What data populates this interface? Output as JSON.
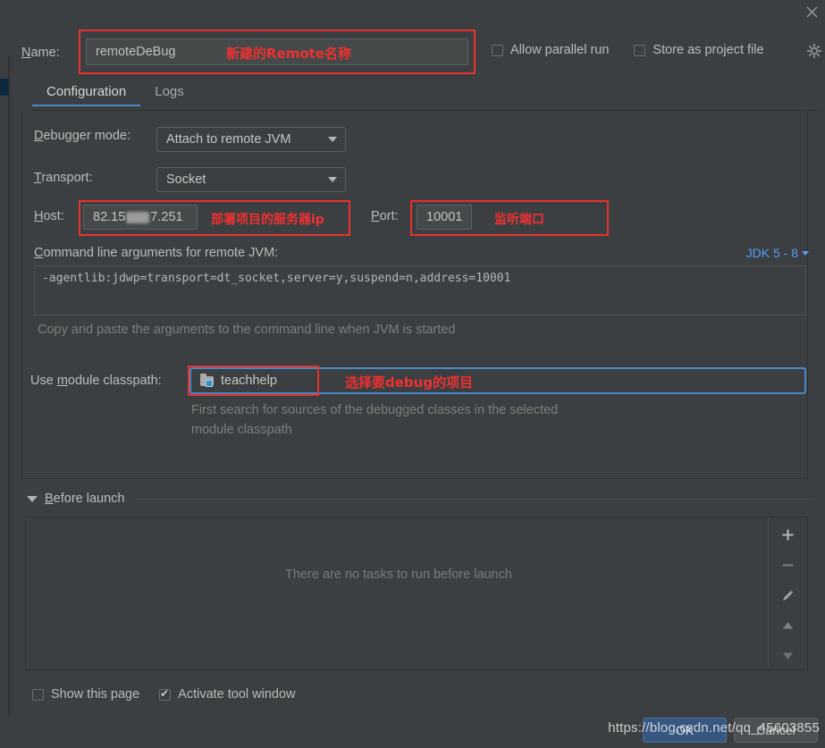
{
  "window": {
    "close_icon": "close-icon",
    "gear_icon": "gear-icon"
  },
  "header": {
    "name_label": "Name:",
    "name_value": "remoteDeBug",
    "name_annotation": "新建的Remote名称",
    "allow_parallel_run_label": "Allow parallel run",
    "allow_parallel_run_checked": false,
    "store_as_project_file_label": "Store as project file",
    "store_as_project_file_checked": false
  },
  "tabs": [
    {
      "label": "Configuration",
      "active": true
    },
    {
      "label": "Logs",
      "active": false
    }
  ],
  "configuration": {
    "debugger_mode_label": "Debugger mode:",
    "debugger_mode_value": "Attach to remote JVM",
    "transport_label": "Transport:",
    "transport_value": "Socket",
    "host_label": "Host:",
    "host_value_prefix": "82.15",
    "host_value_suffix": "7.251",
    "host_annotation": "部署项目的服务器ip",
    "port_label": "Port:",
    "port_value": "10001",
    "port_annotation": "监听端口",
    "cmdline_label": "Command line arguments for remote JVM:",
    "jdk_link": "JDK 5 - 8",
    "cmdline_value": "-agentlib:jdwp=transport=dt_socket,server=y,suspend=n,address=10001",
    "copy_hint": "Copy and paste the arguments to the command line when JVM is started",
    "module_classpath_label": "Use module classpath:",
    "module_classpath_value": "teachhelp",
    "module_classpath_annotation": "选择要debug的项目",
    "module_hint_line1": "First search for sources of the debugged classes in the selected",
    "module_hint_line2": "module classpath"
  },
  "before_launch": {
    "title": "Before launch",
    "empty_text": "There are no tasks to run before launch",
    "toolbar": [
      {
        "name": "add-task-button",
        "glyph": "+"
      },
      {
        "name": "remove-task-button",
        "glyph": "−"
      },
      {
        "name": "edit-task-button",
        "glyph": "✎"
      },
      {
        "name": "move-up-button",
        "glyph": "▲"
      },
      {
        "name": "move-down-button",
        "glyph": "▼"
      }
    ]
  },
  "footer": {
    "show_this_page_label": "Show this page",
    "show_this_page_checked": false,
    "activate_tool_window_label": "Activate tool window",
    "activate_tool_window_checked": true,
    "ok_label": "OK",
    "cancel_label": "Cancel",
    "watermark": "https://blog.csdn.net/qq_45603855"
  },
  "colors": {
    "accent_blue": "#4a88c7",
    "link_blue": "#589df6",
    "annotation_red": "#f03030",
    "highlight_red": "#e8312a",
    "panel_bg": "#3c3f41"
  }
}
